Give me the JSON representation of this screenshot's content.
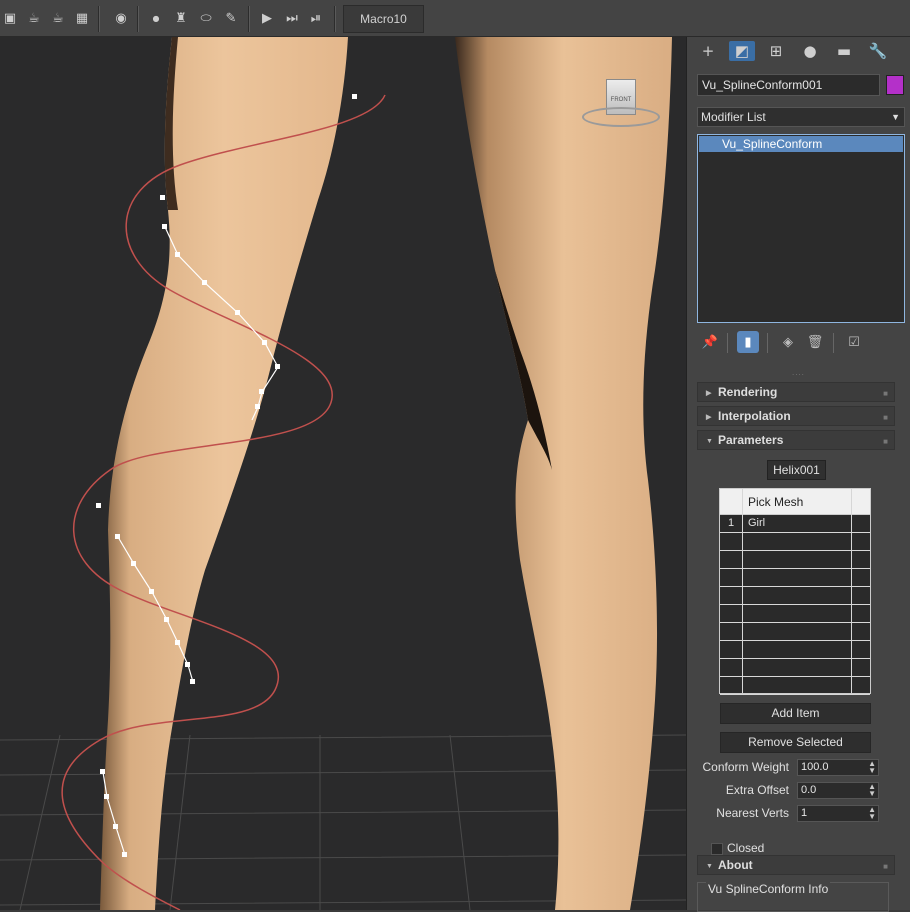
{
  "toolbar": {
    "icons": [
      "render-frame-icon",
      "teapot-render-icon",
      "teapot-render-2-icon",
      "grid-icon",
      "scene-explorer-icon",
      "dot-icon",
      "shirt-icon",
      "capsule-icon",
      "brush-icon",
      "film-play-icon",
      "film-next-icon",
      "film-end-icon"
    ],
    "macro_label": "Macro10"
  },
  "viewport": {
    "viewcube_label": "FRONT",
    "background_color": "#2a2a2b",
    "skin_color": "#e7be95",
    "helix_color": "#c0504d"
  },
  "command_panel": {
    "tabs": [
      "create-icon",
      "modify-icon",
      "hierarchy-icon",
      "motion-icon",
      "display-icon",
      "utilities-icon"
    ],
    "object_name": "Vu_SplineConform001",
    "object_color": "#b430c9",
    "modifier_list_label": "Modifier List",
    "modifier_stack": [
      "Vu_SplineConform"
    ],
    "grip": "....",
    "rollouts": {
      "rendering": "Rendering",
      "interpolation": "Interpolation",
      "parameters": "Parameters",
      "about": "About"
    },
    "parameters": {
      "spline_button": "Helix001",
      "table_header": "Pick Mesh",
      "table_rows": [
        {
          "index": "1",
          "name": "Girl"
        }
      ],
      "add_item_label": "Add Item",
      "remove_selected_label": "Remove Selected",
      "conform_weight_label": "Conform Weight",
      "conform_weight_value": "100.0",
      "extra_offset_label": "Extra Offset",
      "extra_offset_value": "0.0",
      "nearest_verts_label": "Nearest Verts",
      "nearest_verts_value": "1",
      "closed_label": "Closed",
      "closed_checked": false
    },
    "about": {
      "info_label": "Vu SplineConform Info"
    }
  }
}
